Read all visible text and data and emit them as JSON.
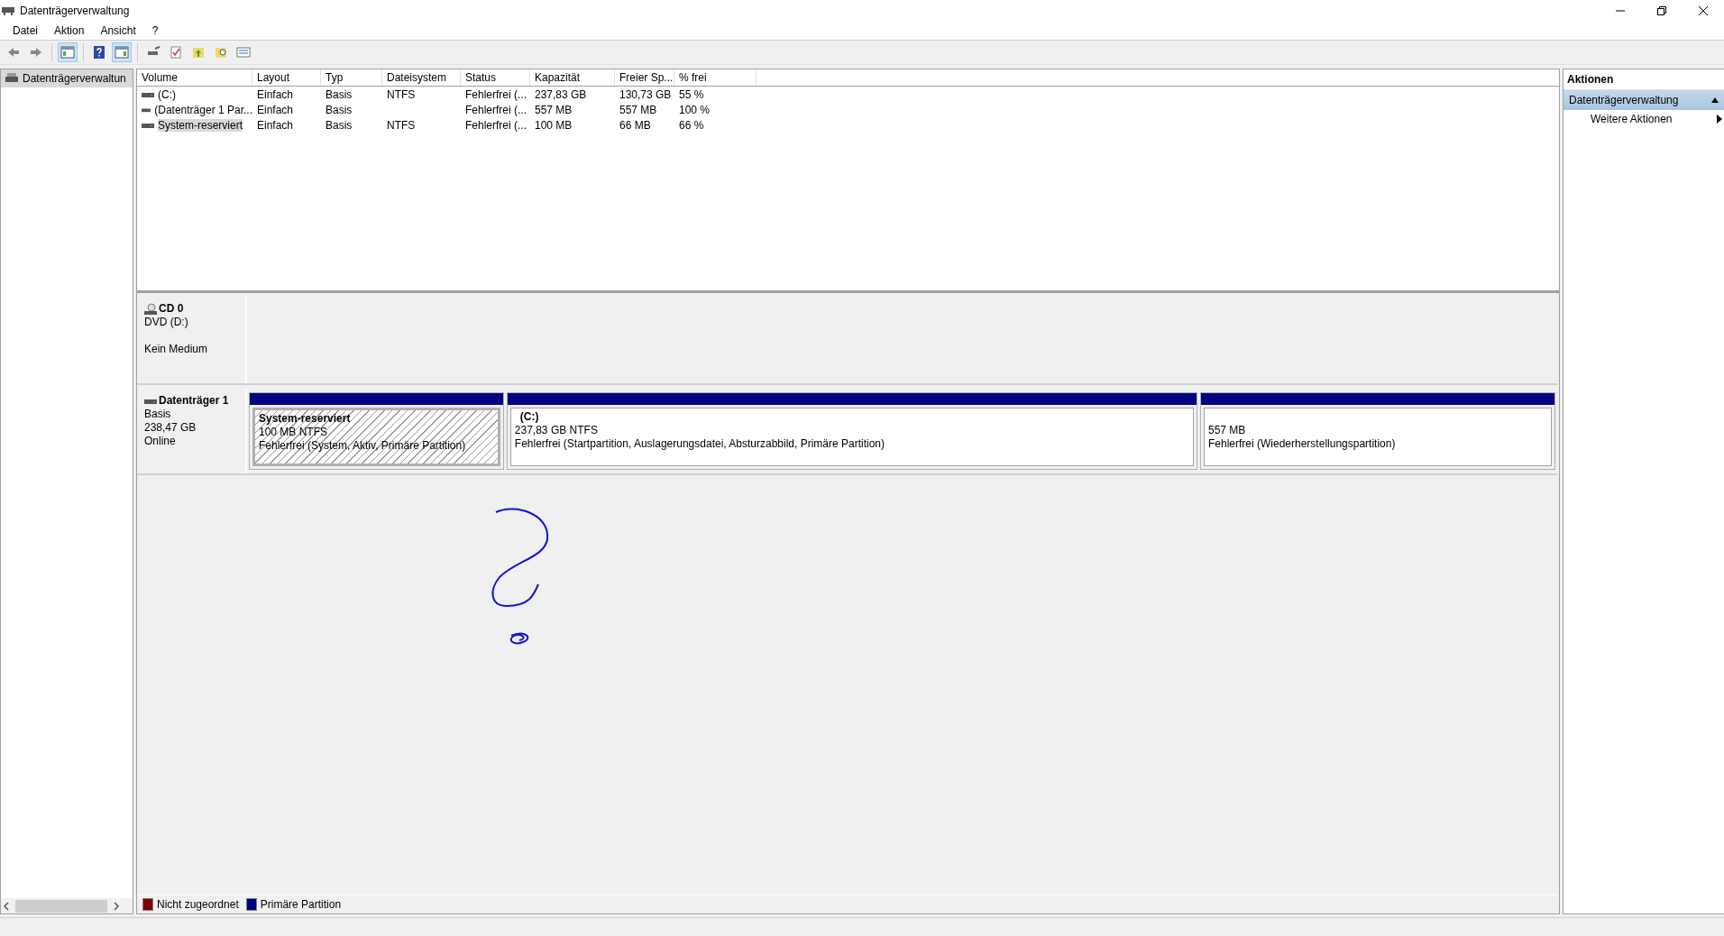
{
  "window": {
    "title": "Datenträgerverwaltung"
  },
  "menu": [
    "Datei",
    "Aktion",
    "Ansicht",
    "?"
  ],
  "tree": {
    "items": [
      {
        "label": "Datenträgerverwaltun",
        "selected": true
      }
    ]
  },
  "table": {
    "columns": [
      "Volume",
      "Layout",
      "Typ",
      "Dateisystem",
      "Status",
      "Kapazität",
      "Freier Sp...",
      "% frei"
    ],
    "rows": [
      {
        "cells": [
          "(C:)",
          "Einfach",
          "Basis",
          "NTFS",
          "Fehlerfrei (...",
          "237,83 GB",
          "130,73 GB",
          "55 %"
        ],
        "selected": false
      },
      {
        "cells": [
          "(Datenträger 1 Par...",
          "Einfach",
          "Basis",
          "",
          "Fehlerfrei (...",
          "557 MB",
          "557 MB",
          "100 %"
        ],
        "selected": false
      },
      {
        "cells": [
          "System-reserviert",
          "Einfach",
          "Basis",
          "NTFS",
          "Fehlerfrei (...",
          "100 MB",
          "66 MB",
          "66 %"
        ],
        "selected": true
      }
    ]
  },
  "disks": [
    {
      "kind": "cd",
      "name": "CD 0",
      "lines": [
        "DVD (D:)",
        "Kein Medium"
      ]
    },
    {
      "kind": "disk",
      "name": "Datenträger 1",
      "lines": [
        "Basis",
        "238,47 GB",
        "Online"
      ],
      "partitions": [
        {
          "title": "System-reserviert",
          "size": "100 MB NTFS",
          "status": "Fehlerfrei (System, Aktiv, Primäre Partition)",
          "selected": true,
          "color": "#000080"
        },
        {
          "title": "(C:)",
          "size": "237,83 GB NTFS",
          "status": "Fehlerfrei (Startpartition, Auslagerungsdatei, Absturzabbild, Primäre Partition)",
          "selected": false,
          "color": "#000080"
        },
        {
          "size": "557 MB",
          "status": "Fehlerfrei (Wiederherstellungspartition)",
          "selected": false,
          "color": "#000080"
        }
      ]
    }
  ],
  "legend": [
    {
      "label": "Nicht zugeordnet",
      "color": "#800000"
    },
    {
      "label": "Primäre Partition",
      "color": "#000080"
    }
  ],
  "actions": {
    "title": "Aktionen",
    "sections": [
      {
        "label": "Datenträgerverwaltung",
        "expanded": true,
        "items": [
          "Weitere Aktionen"
        ]
      }
    ]
  }
}
